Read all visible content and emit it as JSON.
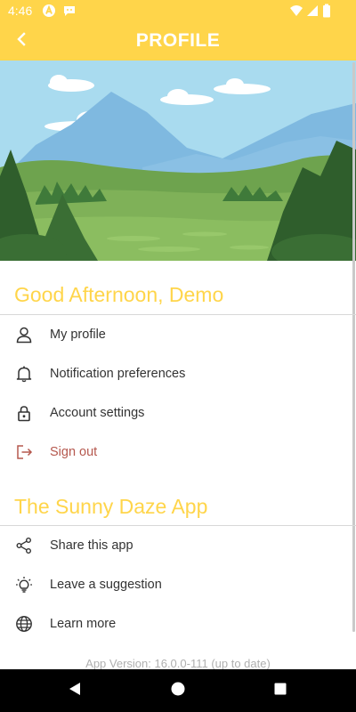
{
  "status_bar": {
    "time": "4:46",
    "left_icons": [
      "auto-a-icon",
      "notification-chat-icon"
    ],
    "right_icons": [
      "wifi-icon",
      "signal-icon",
      "battery-icon"
    ]
  },
  "app_bar": {
    "title": "PROFILE",
    "back_icon": "chevron-left-icon"
  },
  "colors": {
    "accent": "#ffd54a",
    "signout": "#b5584e",
    "text": "#333333"
  },
  "greeting": "Good Afternoon, Demo",
  "account_menu": [
    {
      "label": "My profile",
      "icon": "person-icon"
    },
    {
      "label": "Notification preferences",
      "icon": "bell-icon"
    },
    {
      "label": "Account settings",
      "icon": "lock-icon"
    },
    {
      "label": "Sign out",
      "icon": "sign-out-icon"
    }
  ],
  "app_section_title": "The Sunny Daze App",
  "app_menu": [
    {
      "label": "Share this app",
      "icon": "share-icon"
    },
    {
      "label": "Leave a suggestion",
      "icon": "lightbulb-icon"
    },
    {
      "label": "Learn more",
      "icon": "globe-icon"
    }
  ],
  "version_text": "App Version: 16.0.0-111 (up to date)",
  "nav_bar": [
    "back-triangle-icon",
    "home-circle-icon",
    "recents-square-icon"
  ]
}
